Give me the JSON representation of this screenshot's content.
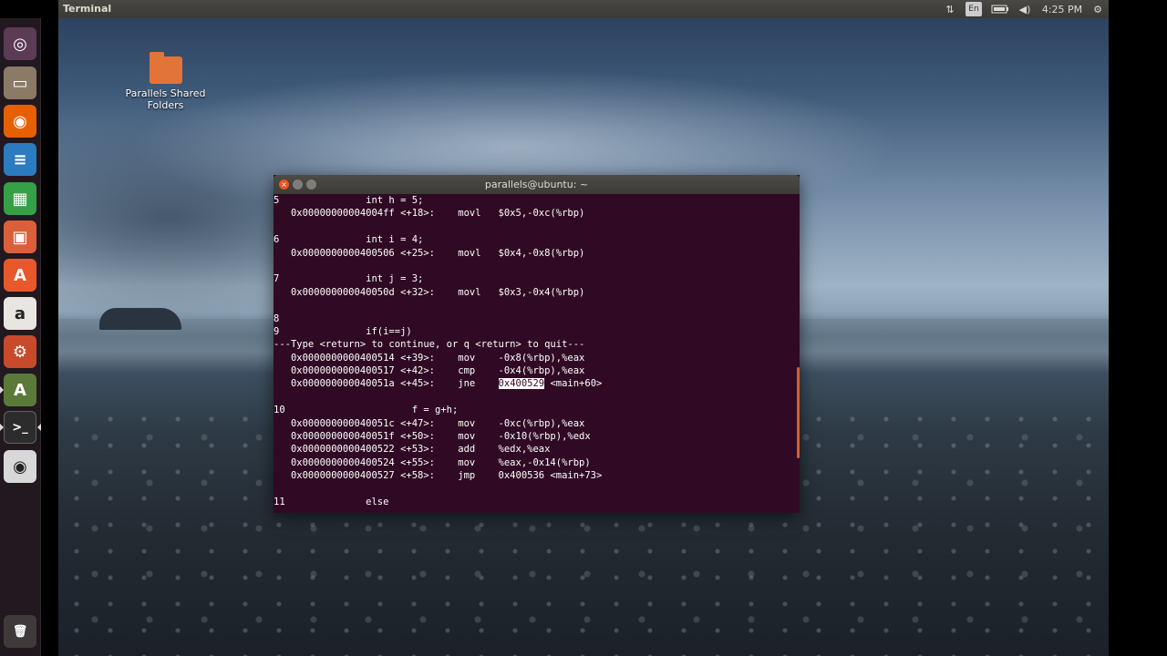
{
  "topbar": {
    "app_title": "Terminal",
    "clock": "4:25 PM",
    "indicators": [
      "network-icon",
      "keyboard-layout-icon",
      "battery-icon",
      "volume-icon",
      "gear-icon"
    ],
    "keyboard_label": "En"
  },
  "launcher": {
    "items": [
      {
        "name": "dash-icon",
        "glyph": "◎",
        "color": "#5c3b54"
      },
      {
        "name": "files-icon",
        "glyph": "▭",
        "color": "#8b7a66"
      },
      {
        "name": "firefox-icon",
        "glyph": "◉",
        "color": "#e66000"
      },
      {
        "name": "writer-icon",
        "glyph": "≡",
        "color": "#2a7bbf"
      },
      {
        "name": "calc-icon",
        "glyph": "▦",
        "color": "#35a046"
      },
      {
        "name": "impress-icon",
        "glyph": "▣",
        "color": "#d9603a"
      },
      {
        "name": "software-center-icon",
        "glyph": "A",
        "color": "#e8582a"
      },
      {
        "name": "amazon-icon",
        "glyph": "a",
        "color": "#e9e5e0"
      },
      {
        "name": "settings-icon",
        "glyph": "⚙",
        "color": "#c84a2b"
      },
      {
        "name": "updater-icon",
        "glyph": "A",
        "color": "#5b7a3a"
      },
      {
        "name": "terminal-icon",
        "glyph": ">_",
        "color": "#2c2c2c"
      },
      {
        "name": "dvd-icon",
        "glyph": "◉",
        "color": "#d8d8d8"
      },
      {
        "name": "trash-icon",
        "glyph": "🗑",
        "color": "#3e3a3a"
      }
    ]
  },
  "desktop": {
    "shared_folder_label_1": "Parallels Shared",
    "shared_folder_label_2": "Folders"
  },
  "terminal": {
    "title": "parallels@ubuntu: ~",
    "lines": [
      "5               int h = 5;",
      "   0x00000000004004ff <+18>:    movl   $0x5,-0xc(%rbp)",
      "",
      "6               int i = 4;",
      "   0x0000000000400506 <+25>:    movl   $0x4,-0x8(%rbp)",
      "",
      "7               int j = 3;",
      "   0x000000000040050d <+32>:    movl   $0x3,-0x4(%rbp)",
      "",
      "8",
      "9               if(i==j)",
      "---Type <return> to continue, or q <return> to quit---",
      "   0x0000000000400514 <+39>:    mov    -0x8(%rbp),%eax",
      "   0x0000000000400517 <+42>:    cmp    -0x4(%rbp),%eax",
      "   0x000000000040051a <+45>:    jne    ",
      "",
      "10                      f = g+h;",
      "   0x000000000040051c <+47>:    mov    -0xc(%rbp),%eax",
      "   0x000000000040051f <+50>:    mov    -0x10(%rbp),%edx",
      "   0x0000000000400522 <+53>:    add    %edx,%eax",
      "   0x0000000000400524 <+55>:    mov    %eax,-0x14(%rbp)",
      "   0x0000000000400527 <+58>:    jmp    0x400536 <main+73>",
      "",
      "11              else"
    ],
    "selected_text": "0x400529",
    "after_selection": " <main+60>",
    "colors": {
      "background": "#300a24",
      "text": "#ffffff",
      "scroll_thumb": "#d35f2c"
    }
  }
}
